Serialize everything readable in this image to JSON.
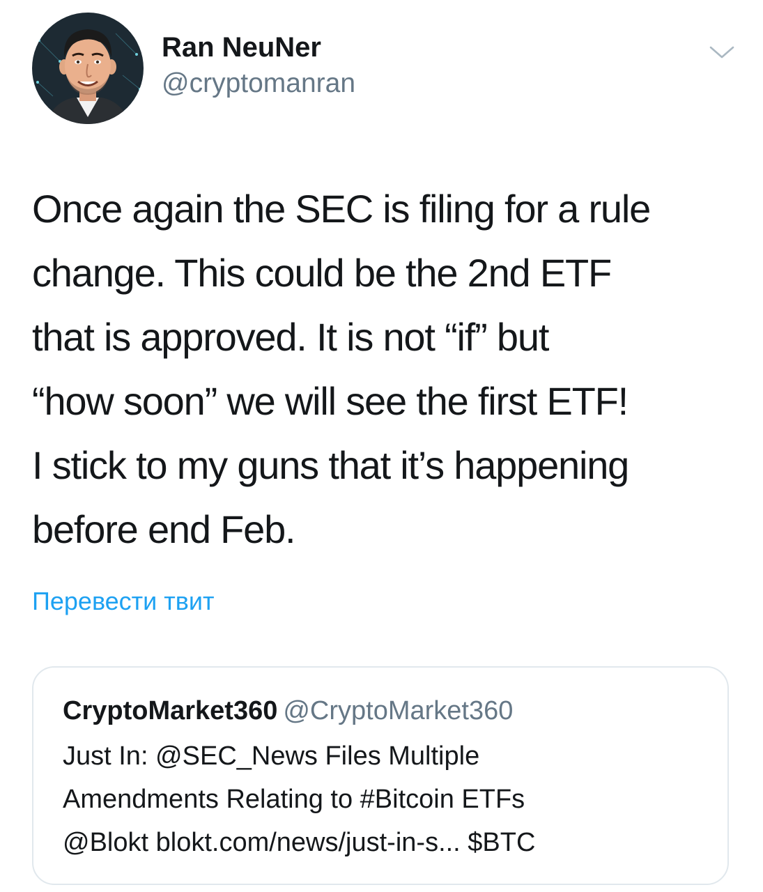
{
  "tweet": {
    "author": {
      "display_name": "Ran NeuNer",
      "handle": "@cryptomanran"
    },
    "text_lines": [
      "Once again the SEC is filing for a rule",
      "change. This could be the 2nd ETF",
      "that is approved. It is not “if” but",
      "“how soon” we will see the first ETF!",
      "I stick to my guns that it’s happening",
      "before end Feb."
    ],
    "translate_label": "Перевести твит",
    "menu_icon": "chevron-down-icon"
  },
  "quoted_tweet": {
    "display_name": "CryptoMarket360",
    "handle": "@CryptoMarket360",
    "text_lines": [
      "Just In: @SEC_News Files Multiple",
      "Amendments Relating to #Bitcoin ETFs",
      "@Blokt blokt.com/news/just-in-s... $BTC"
    ]
  },
  "colors": {
    "text": "#14171a",
    "secondary": "#657786",
    "link": "#1da1f2",
    "border": "#e1e8ed"
  }
}
